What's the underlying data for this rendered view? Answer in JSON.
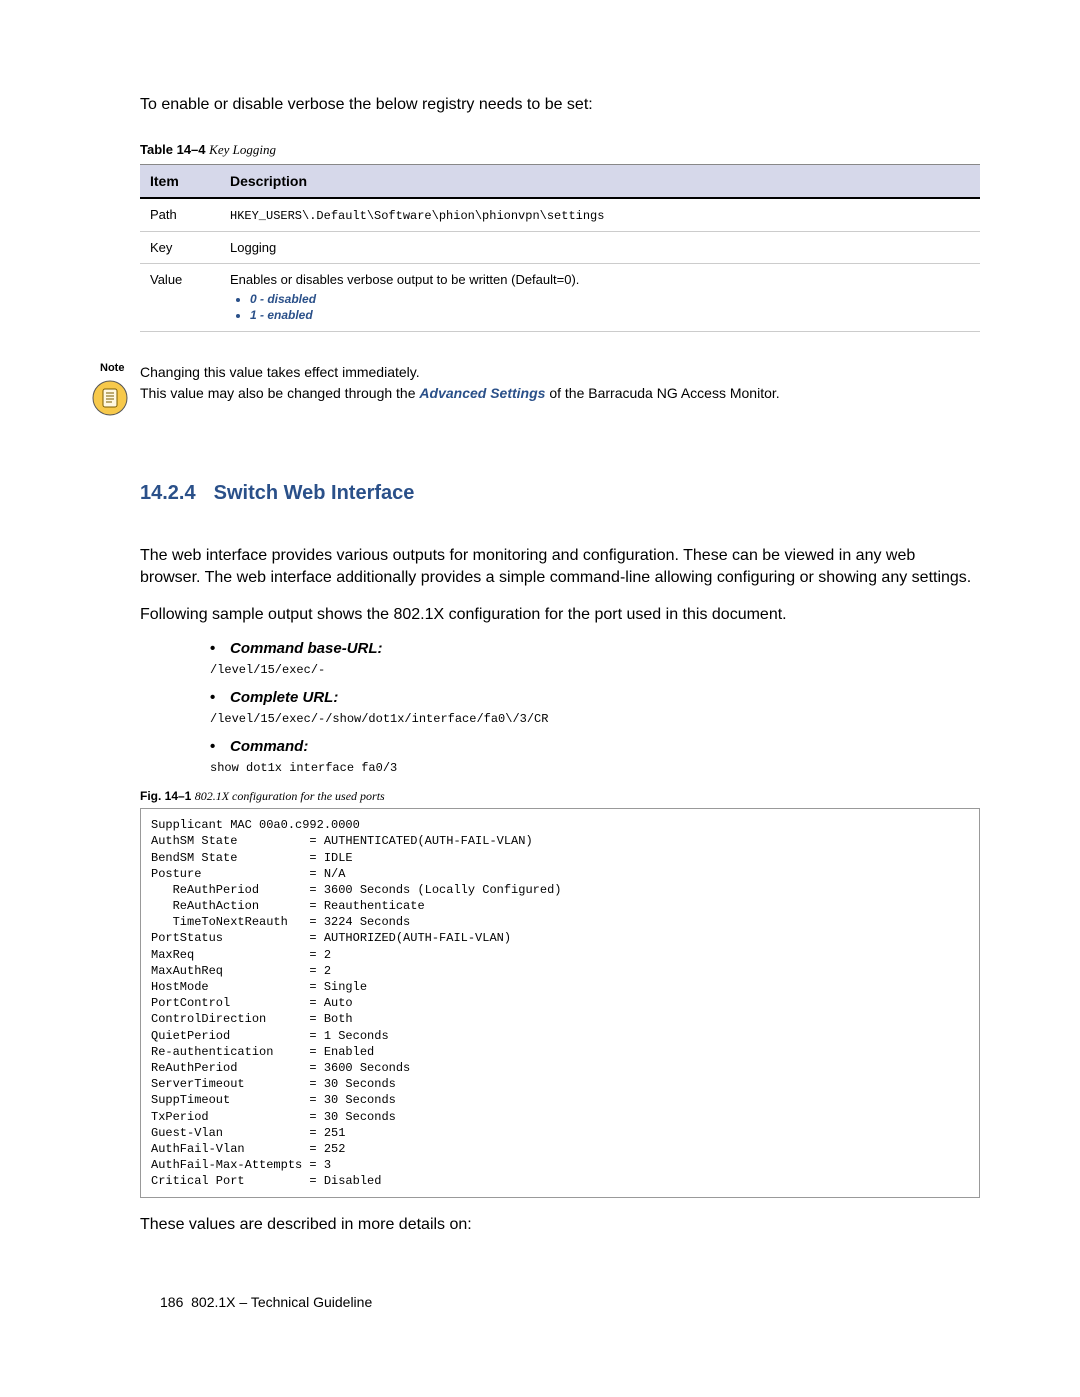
{
  "intro": "To enable or disable verbose the below registry needs to be set:",
  "table_caption": {
    "label": "Table 14–4",
    "title": "Key Logging"
  },
  "table": {
    "headers": [
      "Item",
      "Description"
    ],
    "rows": [
      {
        "item": "Path",
        "desc_mono": "HKEY_USERS\\.Default\\Software\\phion\\phionvpn\\settings"
      },
      {
        "item": "Key",
        "desc": "Logging"
      },
      {
        "item": "Value",
        "desc": "Enables or disables verbose output to be written (Default=0).",
        "bullets": [
          "0 - disabled",
          "1 - enabled"
        ]
      }
    ]
  },
  "note": {
    "label": "Note",
    "line1": "Changing this value takes effect immediately.",
    "line2a": "This value may also be changed through the ",
    "link": "Advanced Settings",
    "line2b": " of the Barracuda NG Access Monitor."
  },
  "section": {
    "num": "14.2.4",
    "title": "Switch Web Interface"
  },
  "para1": "The web interface provides various outputs for monitoring and configuration. These can be viewed in any web browser. The web interface additionally provides a simple command-line allowing configuring or showing any settings.",
  "para2": "Following sample output shows the 802.1X configuration for the port used in this document.",
  "items": [
    {
      "label": "Command base-URL:",
      "code": "/level/15/exec/-"
    },
    {
      "label": "Complete URL:",
      "code": "/level/15/exec/-/show/dot1x/interface/fa0\\/3/CR"
    },
    {
      "label": "Command:",
      "code": "show dot1x interface fa0/3"
    }
  ],
  "fig_caption": {
    "label": "Fig. 14–1",
    "title": "802.1X configuration for the used ports"
  },
  "output": "Supplicant MAC 00a0.c992.0000\nAuthSM State          = AUTHENTICATED(AUTH-FAIL-VLAN)\nBendSM State          = IDLE\nPosture               = N/A\n   ReAuthPeriod       = 3600 Seconds (Locally Configured)\n   ReAuthAction       = Reauthenticate\n   TimeToNextReauth   = 3224 Seconds\nPortStatus            = AUTHORIZED(AUTH-FAIL-VLAN)\nMaxReq                = 2\nMaxAuthReq            = 2\nHostMode              = Single\nPortControl           = Auto\nControlDirection      = Both\nQuietPeriod           = 1 Seconds\nRe-authentication     = Enabled\nReAuthPeriod          = 3600 Seconds\nServerTimeout         = 30 Seconds\nSuppTimeout           = 30 Seconds\nTxPeriod              = 30 Seconds\nGuest-Vlan            = 251\nAuthFail-Vlan         = 252\nAuthFail-Max-Attempts = 3\nCritical Port         = Disabled",
  "closing": "These values are described in more details on:",
  "footer": {
    "page": "186",
    "text": "802.1X – Technical Guideline"
  }
}
